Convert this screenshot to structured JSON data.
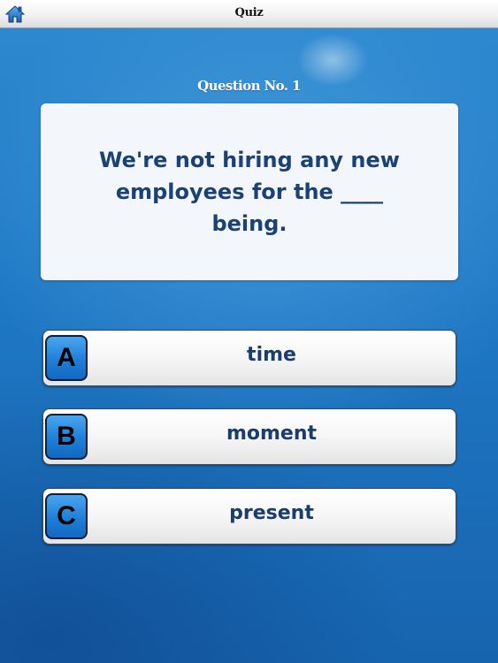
{
  "header": {
    "title": "Quiz",
    "home_icon": "home-icon"
  },
  "question": {
    "number_label": "Question No. 1",
    "text": "We're not hiring any new employees for the ____ being."
  },
  "answers": [
    {
      "letter": "A",
      "label": "time"
    },
    {
      "letter": "B",
      "label": "moment"
    },
    {
      "letter": "C",
      "label": "present"
    }
  ],
  "colors": {
    "background": "#1f78c4",
    "question_text": "#1a4275",
    "badge": "#1f7fd8"
  }
}
